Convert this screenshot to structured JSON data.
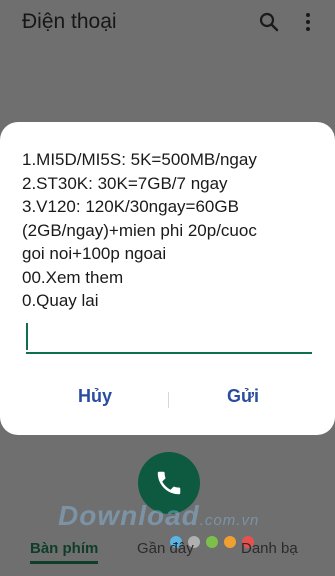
{
  "app": {
    "title": "Điện thoại"
  },
  "icons": {
    "search": "search-icon",
    "more": "more-vert-icon",
    "call": "phone-icon"
  },
  "dialog": {
    "message_lines": [
      "1.MI5D/MI5S: 5K=500MB/ngay",
      "2.ST30K: 30K=7GB/7 ngay",
      "3.V120: 120K/30ngay=60GB",
      "(2GB/ngay)+mien phi 20p/cuoc",
      "goi noi+100p ngoai",
      "00.Xem them",
      "0.Quay lai"
    ],
    "reply_value": "",
    "cancel_label": "Hủy",
    "send_label": "Gửi"
  },
  "tabs": {
    "keypad": "Bàn phím",
    "recents": "Gần đây",
    "contacts": "Danh bạ"
  },
  "watermark": {
    "main": "Download",
    "suffix": ".com.vn"
  },
  "colors": {
    "accent": "#0e6f4d",
    "button_text": "#2a4da0",
    "call_button": "#0d5a40",
    "scrim": "#6f6f6f",
    "watermark_dots": [
      "#5ab4e5",
      "#b0b0b0",
      "#7cc04b",
      "#f0a030",
      "#e85050"
    ]
  }
}
